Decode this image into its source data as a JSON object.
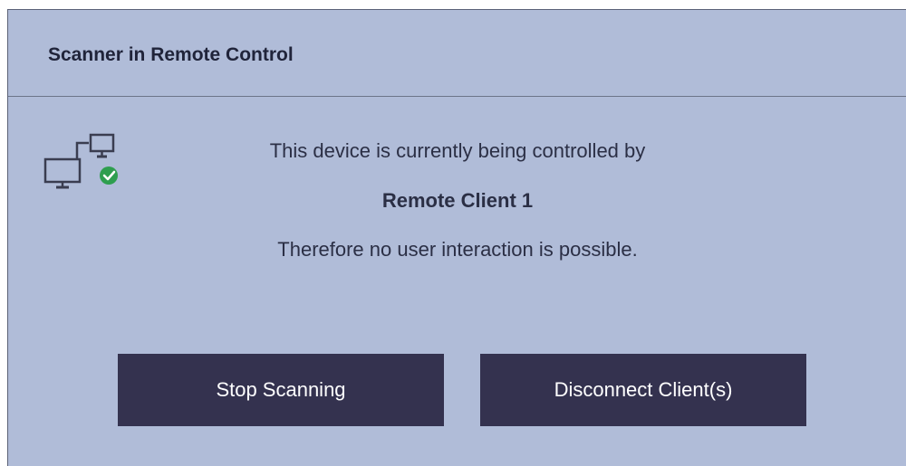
{
  "dialog": {
    "title": "Scanner in Remote Control",
    "icon": "remote-devices-connected-icon",
    "message_line1": "This device is currently being controlled by",
    "client_name": "Remote Client 1",
    "message_line3": "Therefore no user interaction is possible."
  },
  "buttons": {
    "stop_label": "Stop Scanning",
    "disconnect_label": "Disconnect Client(s)"
  },
  "colors": {
    "dialog_background": "#b0bcd8",
    "button_background": "#34324f",
    "status_ok": "#2e9e4f"
  }
}
